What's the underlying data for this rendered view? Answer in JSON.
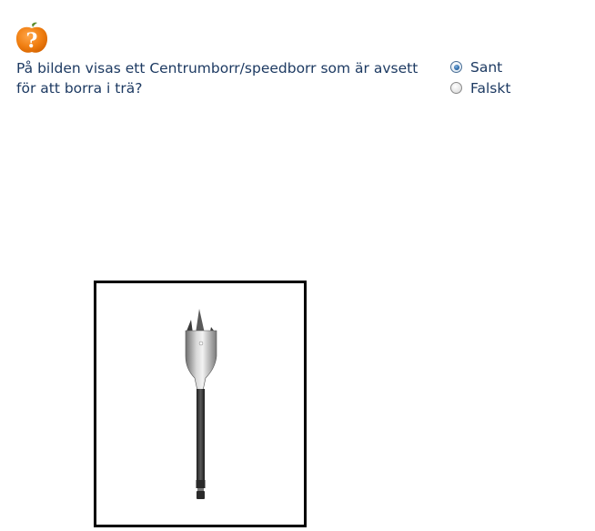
{
  "question": {
    "icon": "apple-question-icon",
    "text": "På bilden visas ett Centrumborr/speedborr som är avsett för att borra i trä?"
  },
  "options": [
    {
      "label": "Sant",
      "selected": true
    },
    {
      "label": "Falskt",
      "selected": false
    }
  ],
  "image": {
    "subject": "spade-drill-bit-icon"
  },
  "colors": {
    "text": "#1d3a62",
    "icon_orange": "#f07f12",
    "frame": "#000000"
  }
}
